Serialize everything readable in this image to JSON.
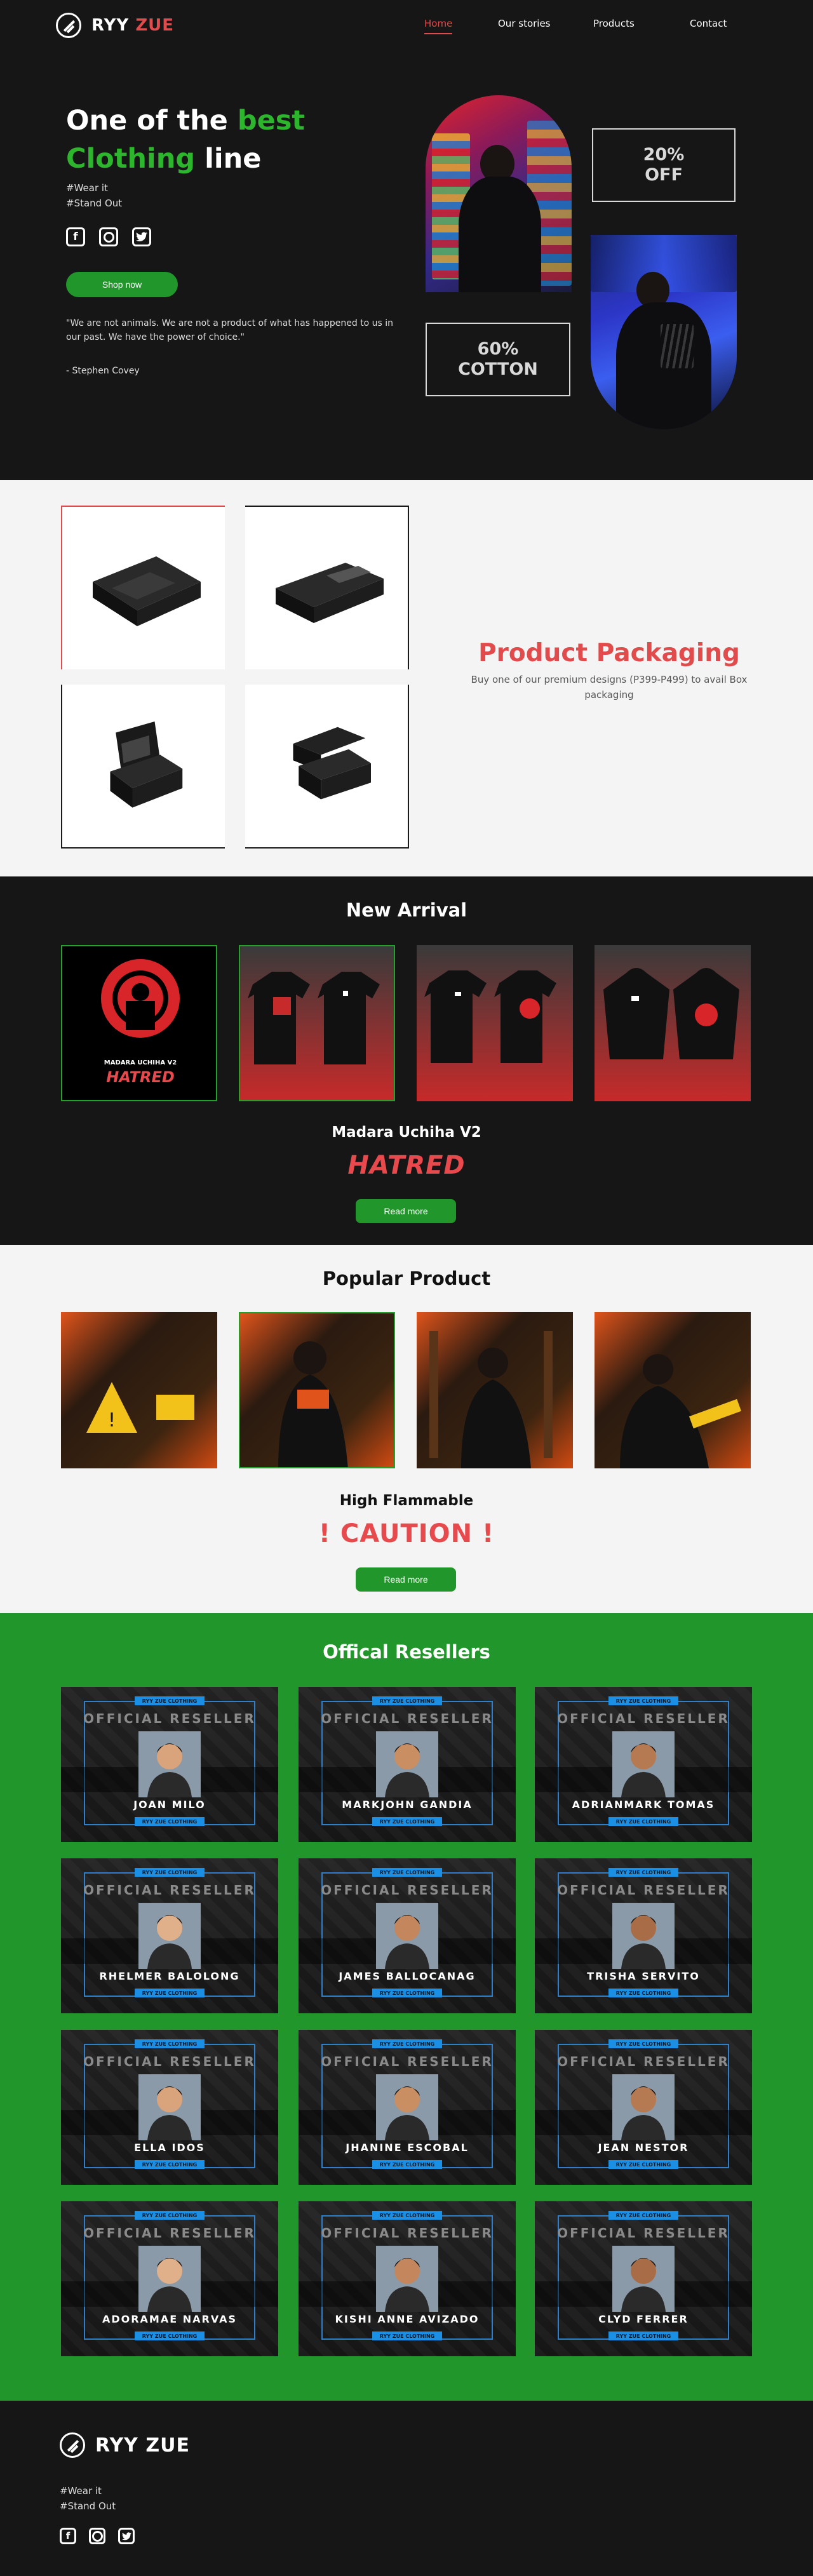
{
  "brand": {
    "name_part1": "RYY",
    "name_part2": "ZUE"
  },
  "nav": {
    "items": [
      "Home",
      "Our stories",
      "Products",
      "Contact"
    ],
    "active": "Home"
  },
  "hero": {
    "title_line1_white": "One of the ",
    "title_line1_green": "best",
    "title_line2_green": "Clothing",
    "title_line2_white": " line",
    "tags": [
      "#Wear it",
      "#Stand Out"
    ],
    "socials": [
      "facebook-icon",
      "instagram-icon",
      "twitter-icon"
    ],
    "cta": "Shop now",
    "quote": "\"We are not animals. We are not a product of what has happened to us in our past. We have the power of choice.\"",
    "author": "- Stephen Covey",
    "badge1_line1": "20%",
    "badge1_line2": "OFF",
    "badge2_line1": "60%",
    "badge2_line2": "COTTON"
  },
  "packaging": {
    "title": "Product Packaging",
    "subtitle": "Buy one of our premium designs (P399-P499) to avail Box packaging"
  },
  "new_arrival": {
    "title": "New Arrival",
    "featured_name": "Madara Uchiha V2",
    "featured_logo": "HATRED",
    "card1_caption": "MADARA UCHIHA V2",
    "card1_logo": "HATRED",
    "button": "Read more"
  },
  "popular": {
    "title": "Popular Product",
    "featured_name": "High Flammable",
    "featured_logo": "! CAUTION !",
    "button": "Read more"
  },
  "resellers": {
    "title": "Offical Resellers",
    "tag_text": "RYY ZUE CLOTHING",
    "heading": "OFFICIAL RESELLER",
    "names": [
      "JOAN MILO",
      "MARKJOHN GANDIA",
      "ADRIANMARK TOMAS",
      "RHELMER BALOLONG",
      "JAMES BALLOCANAG",
      "TRISHA SERVITO",
      "ELLA IDOS",
      "JHANINE ESCOBAL",
      "JEAN NESTOR",
      "ADORAMAE NARVAS",
      "KISHI ANNE AVIZADO",
      "CLYD FERRER"
    ]
  },
  "footer": {
    "tags": [
      "#Wear it",
      "#Stand Out"
    ]
  },
  "colors": {
    "accent_red": "#e14b4b",
    "accent_green": "#21962a",
    "dark_bg": "#161616",
    "light_bg": "#f4f4f4",
    "reseller_blue": "#1a8fe3"
  }
}
